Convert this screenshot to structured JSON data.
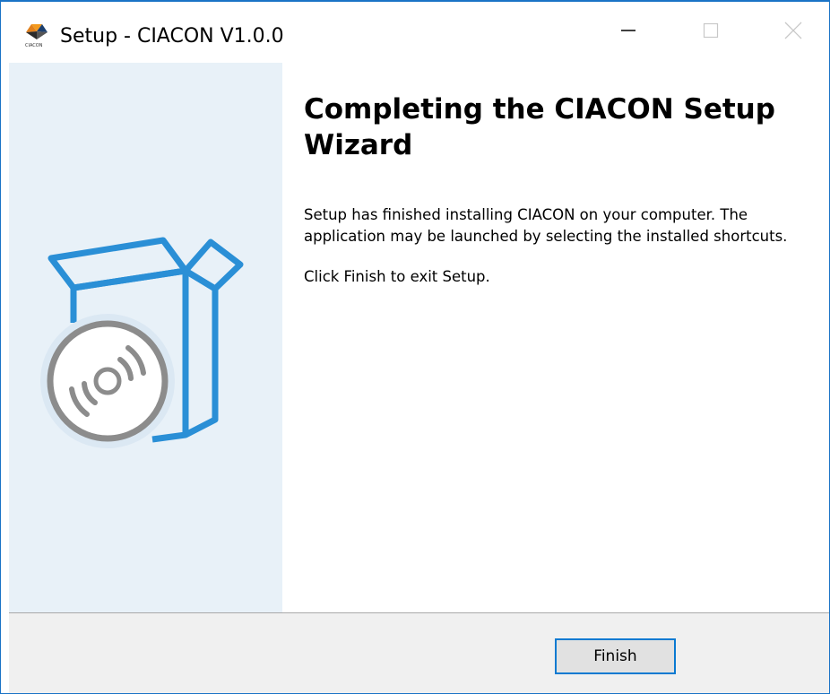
{
  "window": {
    "title": "Setup - CIACON V1.0.0"
  },
  "icons": {
    "app": "app-logo-icon",
    "minimize": "minimize-icon",
    "maximize": "maximize-icon",
    "close": "close-icon",
    "banner": "box-with-disc-illustration"
  },
  "content": {
    "heading": "Completing the CIACON Setup Wizard",
    "paragraph1": "Setup has finished installing CIACON on your computer. The application may be launched by selecting the installed shortcuts.",
    "paragraph2": "Click Finish to exit Setup."
  },
  "buttons": {
    "finish": "Finish"
  },
  "colors": {
    "accent": "#1a73c6",
    "panel_bg": "#e8f1f8",
    "illustration_blue": "#2a8fd6",
    "disc_gray": "#8c8c8c",
    "footer_bg": "#f0f0f0"
  }
}
